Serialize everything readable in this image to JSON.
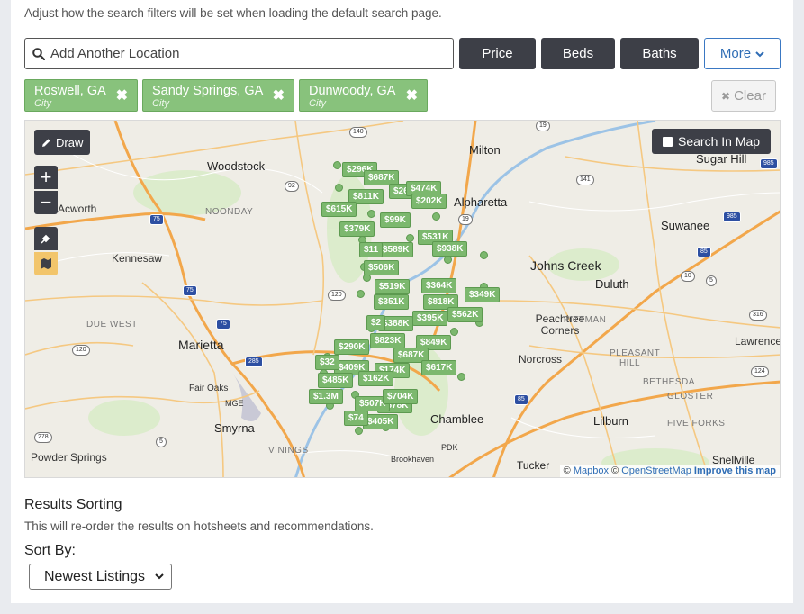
{
  "intro_text": "Adjust how the search filters will be set when loading the default search page.",
  "search": {
    "placeholder": "Add Another Location",
    "icon": "search-icon"
  },
  "filters": {
    "price": "Price",
    "beds": "Beds",
    "baths": "Baths",
    "more": "More"
  },
  "chips": [
    {
      "name": "Roswell, GA",
      "type": "City"
    },
    {
      "name": "Sandy Springs, GA",
      "type": "City"
    },
    {
      "name": "Dunwoody, GA",
      "type": "City"
    }
  ],
  "chip_remove_glyph": "✖",
  "clear_label": "Clear",
  "map": {
    "draw_label": "Draw",
    "zoom_in": "+",
    "zoom_out": "−",
    "search_in_map_label": "Search In Map",
    "attribution": {
      "copyright": "©",
      "mapbox": "Mapbox",
      "osm": "OpenStreetMap",
      "improve": "Improve this map"
    },
    "places": [
      "Woodstock",
      "Milton",
      "Alpharetta",
      "Sugar Hill",
      "Acworth",
      "NOONDAY",
      "Suwanee",
      "Kennesaw",
      "Johns Creek",
      "Duluth",
      "DUE WEST",
      "Marietta",
      "Peachtree Corners",
      "PITTMAN",
      "Lawrencev",
      "Norcross",
      "PLEASANT HILL",
      "BETHESDA",
      "GLOSTER",
      "Fair Oaks",
      "MGE",
      "Smyrna",
      "Chamblee",
      "Lilburn",
      "FIVE FORKS",
      "Powder Springs",
      "VININGS",
      "Brookhaven",
      "PDK",
      "Tucker",
      "Snellville"
    ],
    "shields": [
      "140",
      "19",
      "92",
      "141",
      "985",
      "75",
      "19",
      "985",
      "120",
      "85",
      "75",
      "316",
      "120",
      "75",
      "124",
      "278",
      "5",
      "285",
      "85",
      "10",
      "5"
    ],
    "prices": [
      "$296K",
      "$687K",
      "$811K",
      "$260K",
      "$474K",
      "$202K",
      "$615K",
      "$379K",
      "$531K",
      "$589K",
      "$938K",
      "$506K",
      "$519K",
      "$364K",
      "$349K",
      "$351K",
      "$818K",
      "$395K",
      "$562K",
      "$388K",
      "$823K",
      "$290K",
      "$849K",
      "$687K",
      "$409K",
      "$174K",
      "$617K",
      "$485K",
      "$162K",
      "$1.3M",
      "$678K",
      "$405K",
      "$507K",
      "$704K",
      "$74",
      "$32",
      "$11",
      "$99K",
      "$2"
    ]
  },
  "sorting": {
    "heading": "Results Sorting",
    "description": "This will re-order the results on hotsheets and recommendations.",
    "sort_by_label": "Sort By:",
    "selected": "Newest Listings"
  }
}
